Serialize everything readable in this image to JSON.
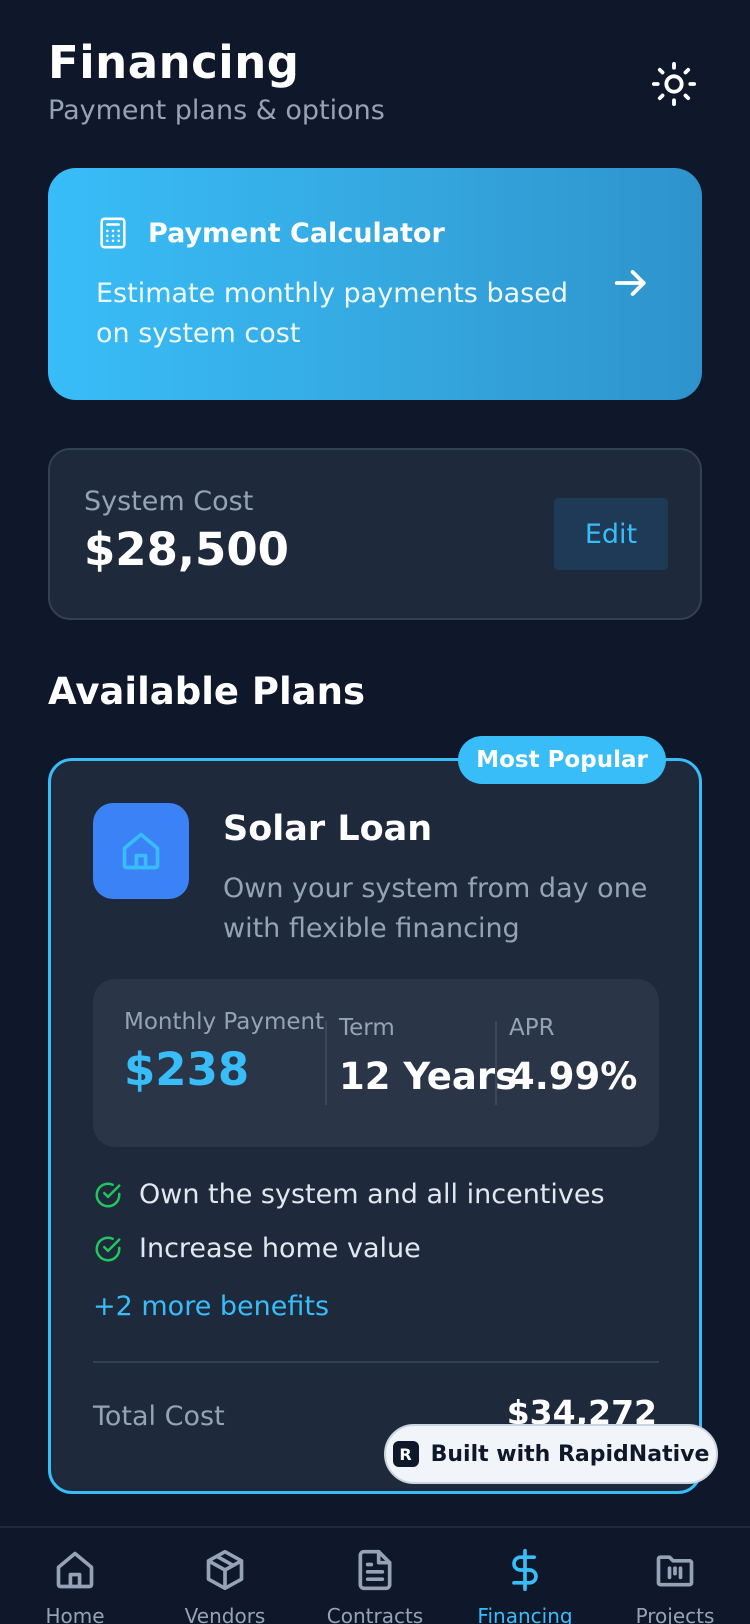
{
  "header": {
    "title": "Financing",
    "subtitle": "Payment plans & options",
    "theme_icon": "sun-icon"
  },
  "calculator": {
    "title": "Payment Calculator",
    "description": "Estimate monthly payments based on system cost",
    "icon": "calculator-icon",
    "arrow_icon": "arrow-right-icon"
  },
  "system_cost": {
    "label": "System Cost",
    "value": "$28,500",
    "edit_label": "Edit"
  },
  "plans_section": {
    "title": "Available Plans"
  },
  "plan": {
    "badge": "Most Popular",
    "icon": "home-icon",
    "name": "Solar Loan",
    "description": "Own your system from day one with flexible financing",
    "metrics": [
      {
        "label": "Monthly Payment",
        "value": "$238"
      },
      {
        "label": "Term",
        "value": "12 Years"
      },
      {
        "label": "APR",
        "value": "4.99%"
      }
    ],
    "benefits": [
      "Own the system and all incentives",
      "Increase home value"
    ],
    "more_benefits": "+2 more benefits",
    "total_label": "Total Cost",
    "total_value": "$34,272"
  },
  "built_with": {
    "logo_letter": "R",
    "label": "Built with RapidNative"
  },
  "tabbar": {
    "tabs": [
      {
        "label": "Home",
        "icon": "home-icon"
      },
      {
        "label": "Vendors",
        "icon": "package-icon"
      },
      {
        "label": "Contracts",
        "icon": "document-icon"
      },
      {
        "label": "Financing",
        "icon": "dollar-icon",
        "active": true
      },
      {
        "label": "Projects",
        "icon": "folder-icon"
      }
    ]
  },
  "colors": {
    "background": "#0f172a",
    "card": "#1e293b",
    "accent": "#38bdf8",
    "success": "#22c55e",
    "plan_icon_bg": "#3b82f6"
  }
}
